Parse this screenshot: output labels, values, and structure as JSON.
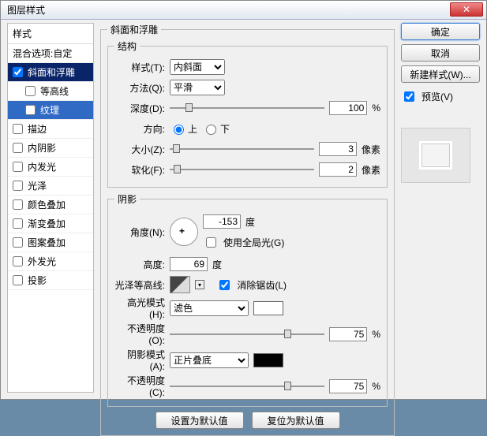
{
  "window": {
    "title": "图层样式"
  },
  "sidebar": {
    "header": "样式",
    "blend": "混合选项:自定",
    "items": [
      {
        "label": "斜面和浮雕",
        "checked": true
      },
      {
        "label": "等高线",
        "checked": false
      },
      {
        "label": "纹理",
        "checked": false
      },
      {
        "label": "描边",
        "checked": false
      },
      {
        "label": "内阴影",
        "checked": false
      },
      {
        "label": "内发光",
        "checked": false
      },
      {
        "label": "光泽",
        "checked": false
      },
      {
        "label": "颜色叠加",
        "checked": false
      },
      {
        "label": "渐变叠加",
        "checked": false
      },
      {
        "label": "图案叠加",
        "checked": false
      },
      {
        "label": "外发光",
        "checked": false
      },
      {
        "label": "投影",
        "checked": false
      }
    ]
  },
  "panel": {
    "group_title": "斜面和浮雕",
    "structure": {
      "legend": "结构",
      "style_label": "样式(T):",
      "style_value": "内斜面",
      "tech_label": "方法(Q):",
      "tech_value": "平滑",
      "depth_label": "深度(D):",
      "depth_value": "100",
      "pct": "%",
      "dir_label": "方向:",
      "up": "上",
      "down": "下",
      "size_label": "大小(Z):",
      "size_value": "3",
      "px": "像素",
      "soften_label": "软化(F):",
      "soften_value": "2"
    },
    "shadow": {
      "legend": "阴影",
      "angle_label": "角度(N):",
      "angle_value": "-153",
      "deg": "度",
      "global_label": "使用全局光(G)",
      "altitude_label": "高度:",
      "altitude_value": "69",
      "gloss_label": "光泽等高线:",
      "antialias_label": "消除锯齿(L)",
      "hl_label": "高光模式(H):",
      "hl_value": "滤色",
      "hl_color": "#ffffff",
      "opacity_label": "不透明度(O):",
      "hl_opacity": "75",
      "sh_label": "阴影模式(A):",
      "sh_value": "正片叠底",
      "sh_color": "#000000",
      "sh_opacity_label": "不透明度(C):",
      "sh_opacity": "75"
    },
    "reset_btn": "设置为默认值",
    "reset_to_btn": "复位为默认值"
  },
  "right": {
    "ok": "确定",
    "cancel": "取消",
    "newstyle": "新建样式(W)...",
    "preview": "预览(V)"
  }
}
